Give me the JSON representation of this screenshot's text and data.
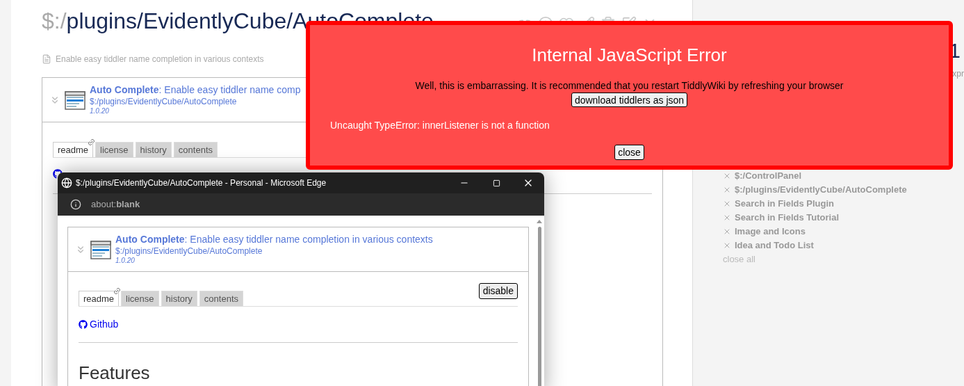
{
  "story": {
    "title_prefix": "$:/",
    "title_path": "plugins/EvidentlyCube/AutoComplete",
    "subtitle": "Enable easy tiddler name completion in various contexts",
    "plugin": {
      "heading": "**Auto Complete**: Enable easy tiddler name comp",
      "path": "$:/plugins/EvidentlyCube/AutoComplete",
      "version": "1.0.20",
      "tabs": [
        {
          "label": "readme",
          "selected": true
        },
        {
          "label": "license",
          "selected": false
        },
        {
          "label": "history",
          "selected": false
        },
        {
          "label": "contents",
          "selected": false
        }
      ]
    }
  },
  "popup": {
    "title": "$:/plugins/EvidentlyCube/AutoComplete - Personal - Microsoft Edge",
    "address": "about:**blank**",
    "plugin": {
      "heading": "**Auto Complete**: Enable easy tiddler name completion in various contexts",
      "path": "$:/plugins/EvidentlyCube/AutoComplete",
      "version": "1.0.20",
      "tabs": [
        {
          "label": "readme",
          "selected": true
        },
        {
          "label": "license",
          "selected": false
        },
        {
          "label": "history",
          "selected": false
        },
        {
          "label": "contents",
          "selected": false
        }
      ],
      "button": "disable"
    },
    "link": "Github",
    "heading": "Features"
  },
  "error": {
    "title": "Internal JavaScript Error",
    "message": "Well, this is embarrassing. It is recommended that you restart TiddlyWiki by refreshing your browser",
    "download_button": "download tiddlers as json",
    "details": "Uncaught TypeError: innerListener is not a function",
    "close_button": "close"
  },
  "sidebar": {
    "title_fragment": "1",
    "subtitle_fragment": "xpr",
    "open_tiddlers": [
      {
        "label": "$:/ControlPanel"
      },
      {
        "label": "$:/plugins/EvidentlyCube/AutoComplete"
      },
      {
        "label": "Search in Fields Plugin"
      },
      {
        "label": "Search in Fields Tutorial"
      },
      {
        "label": "Image and Icons"
      },
      {
        "label": "Idea and Todo List"
      }
    ],
    "close_all": "close all"
  }
}
